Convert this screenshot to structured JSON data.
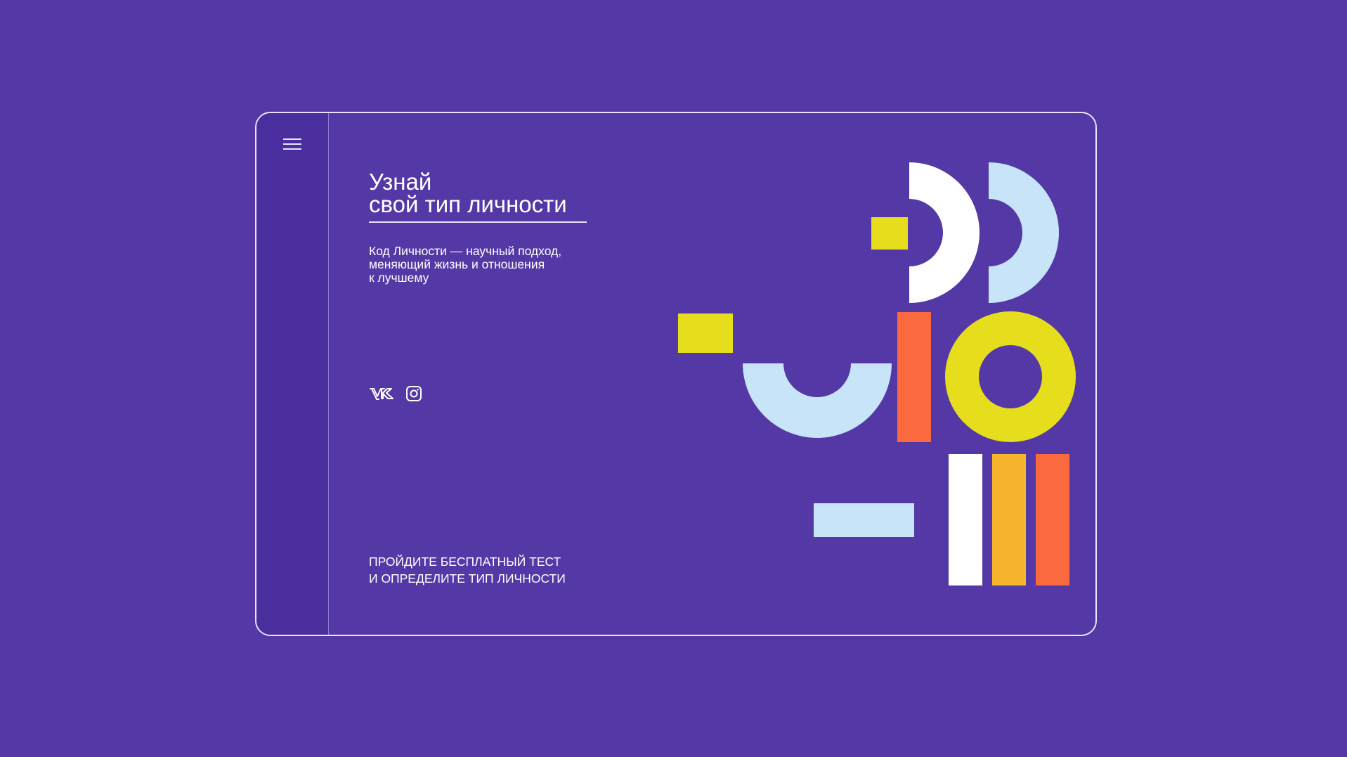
{
  "sidebar": {
    "menu_icon": "hamburger-menu-icon"
  },
  "hero": {
    "title_line1": "Узнай",
    "title_line2": "свой тип личности",
    "description_line1": "Код Личности — научный подход,",
    "description_line2": "меняющий жизнь и отношения",
    "description_line3": "к лучшему"
  },
  "socials": [
    {
      "name": "vk",
      "icon": "vk-icon"
    },
    {
      "name": "instagram",
      "icon": "instagram-icon"
    }
  ],
  "cta": {
    "line1": "ПРОЙДИТЕ БЕСПЛАТНЫЙ ТЕСТ",
    "line2": "И ОПРЕДЕЛИТЕ ТИП ЛИЧНОСТИ"
  },
  "colors": {
    "background": "#5439a6",
    "sidebar": "#4a2e9e",
    "white": "#ffffff",
    "light_blue": "#c8e4f8",
    "yellow": "#e6dd1c",
    "orange": "#fb6a3e",
    "amber": "#f7b52e"
  }
}
